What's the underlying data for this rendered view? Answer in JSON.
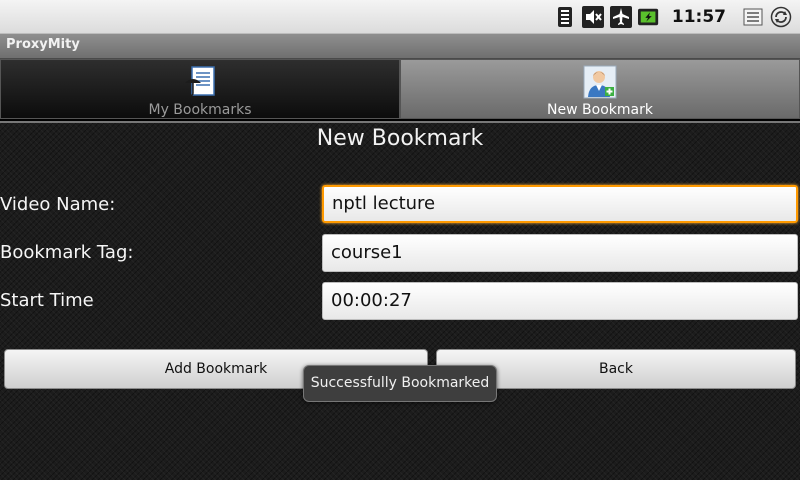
{
  "status_bar": {
    "time": "11:57",
    "icons": [
      "wifi-icon",
      "mute-icon",
      "airplane-icon",
      "battery-icon",
      "list-icon",
      "sync-icon"
    ]
  },
  "app": {
    "title": "ProxyMity"
  },
  "tabs": [
    {
      "label": "My Bookmarks",
      "icon": "bookmarks-document-icon",
      "active": false
    },
    {
      "label": "New Bookmark",
      "icon": "person-icon",
      "active": true
    }
  ],
  "form": {
    "heading": "New Bookmark",
    "video_name": {
      "label": "Video Name:",
      "value": "nptl lecture"
    },
    "bookmark_tag": {
      "label": "Bookmark Tag:",
      "value": "course1"
    },
    "start_time": {
      "label": "Start Time",
      "value": "00:00:27"
    }
  },
  "buttons": {
    "add_label": "Add Bookmark",
    "back_label": "Back"
  },
  "toast": {
    "message": "Successfully Bookmarked"
  },
  "colors": {
    "focus_accent": "#ff9a00",
    "background": "#1c1c1c"
  }
}
